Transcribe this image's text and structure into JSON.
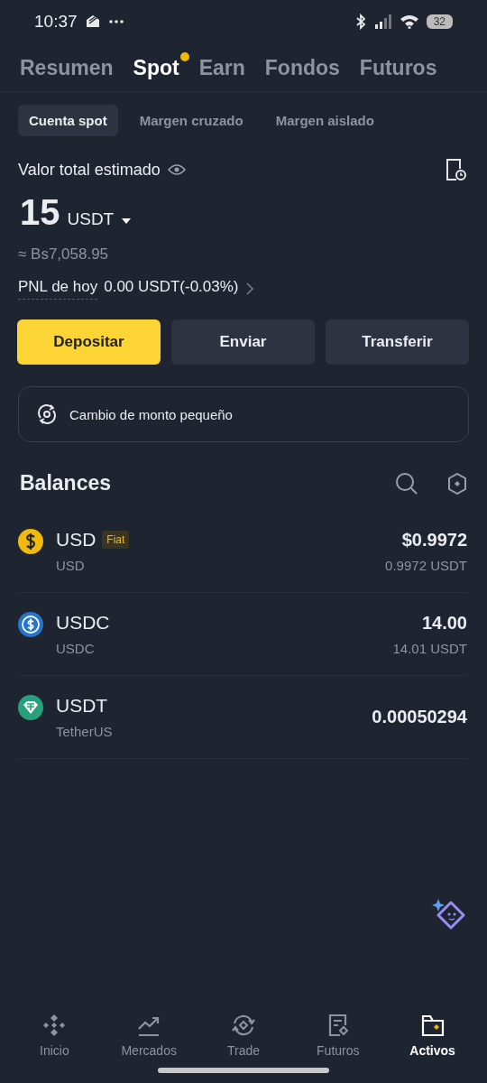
{
  "status_bar": {
    "time": "10:37",
    "battery": "32"
  },
  "tabs": [
    {
      "label": "Resumen",
      "selected": false,
      "dot": false
    },
    {
      "label": "Spot",
      "selected": true,
      "dot": true
    },
    {
      "label": "Earn",
      "selected": false,
      "dot": false
    },
    {
      "label": "Fondos",
      "selected": false,
      "dot": false
    },
    {
      "label": "Futuros",
      "selected": false,
      "dot": false
    }
  ],
  "subtabs": [
    {
      "label": "Cuenta spot",
      "selected": true
    },
    {
      "label": "Margen cruzado",
      "selected": false
    },
    {
      "label": "Margen aislado",
      "selected": false
    }
  ],
  "total": {
    "label": "Valor total estimado",
    "amount": "15",
    "unit": "USDT",
    "fiat": "≈ Bs7,058.95",
    "pnl_label": "PNL de hoy",
    "pnl_value": "0.00 USDT(-0.03%)"
  },
  "actions": [
    {
      "label": "Depositar",
      "kind": "primary"
    },
    {
      "label": "Enviar",
      "kind": "secondary"
    },
    {
      "label": "Transferir",
      "kind": "secondary"
    }
  ],
  "small_exchange": "Cambio de monto pequeño",
  "balances": {
    "title": "Balances",
    "assets": [
      {
        "symbol": "USD",
        "tag": "Fiat",
        "name": "USD",
        "value": "$0.9972",
        "sub_value": "0.9972 USDT",
        "kind": "dollar",
        "color": "#f0b90b"
      },
      {
        "symbol": "USDC",
        "name": "USDC",
        "value": "14.00",
        "sub_value": "14.01 USDT",
        "kind": "usdc",
        "color": "#2775ca"
      },
      {
        "symbol": "USDT",
        "name": "TetherUS",
        "value": "0.00050294",
        "kind": "tether",
        "color": "#26a17b"
      }
    ]
  },
  "nav": [
    {
      "label": "Inicio",
      "kind": "home",
      "selected": false
    },
    {
      "label": "Mercados",
      "kind": "markets",
      "selected": false
    },
    {
      "label": "Trade",
      "kind": "trade",
      "selected": false
    },
    {
      "label": "Futuros",
      "kind": "futures",
      "selected": false
    },
    {
      "label": "Activos",
      "kind": "assets",
      "selected": true
    }
  ]
}
